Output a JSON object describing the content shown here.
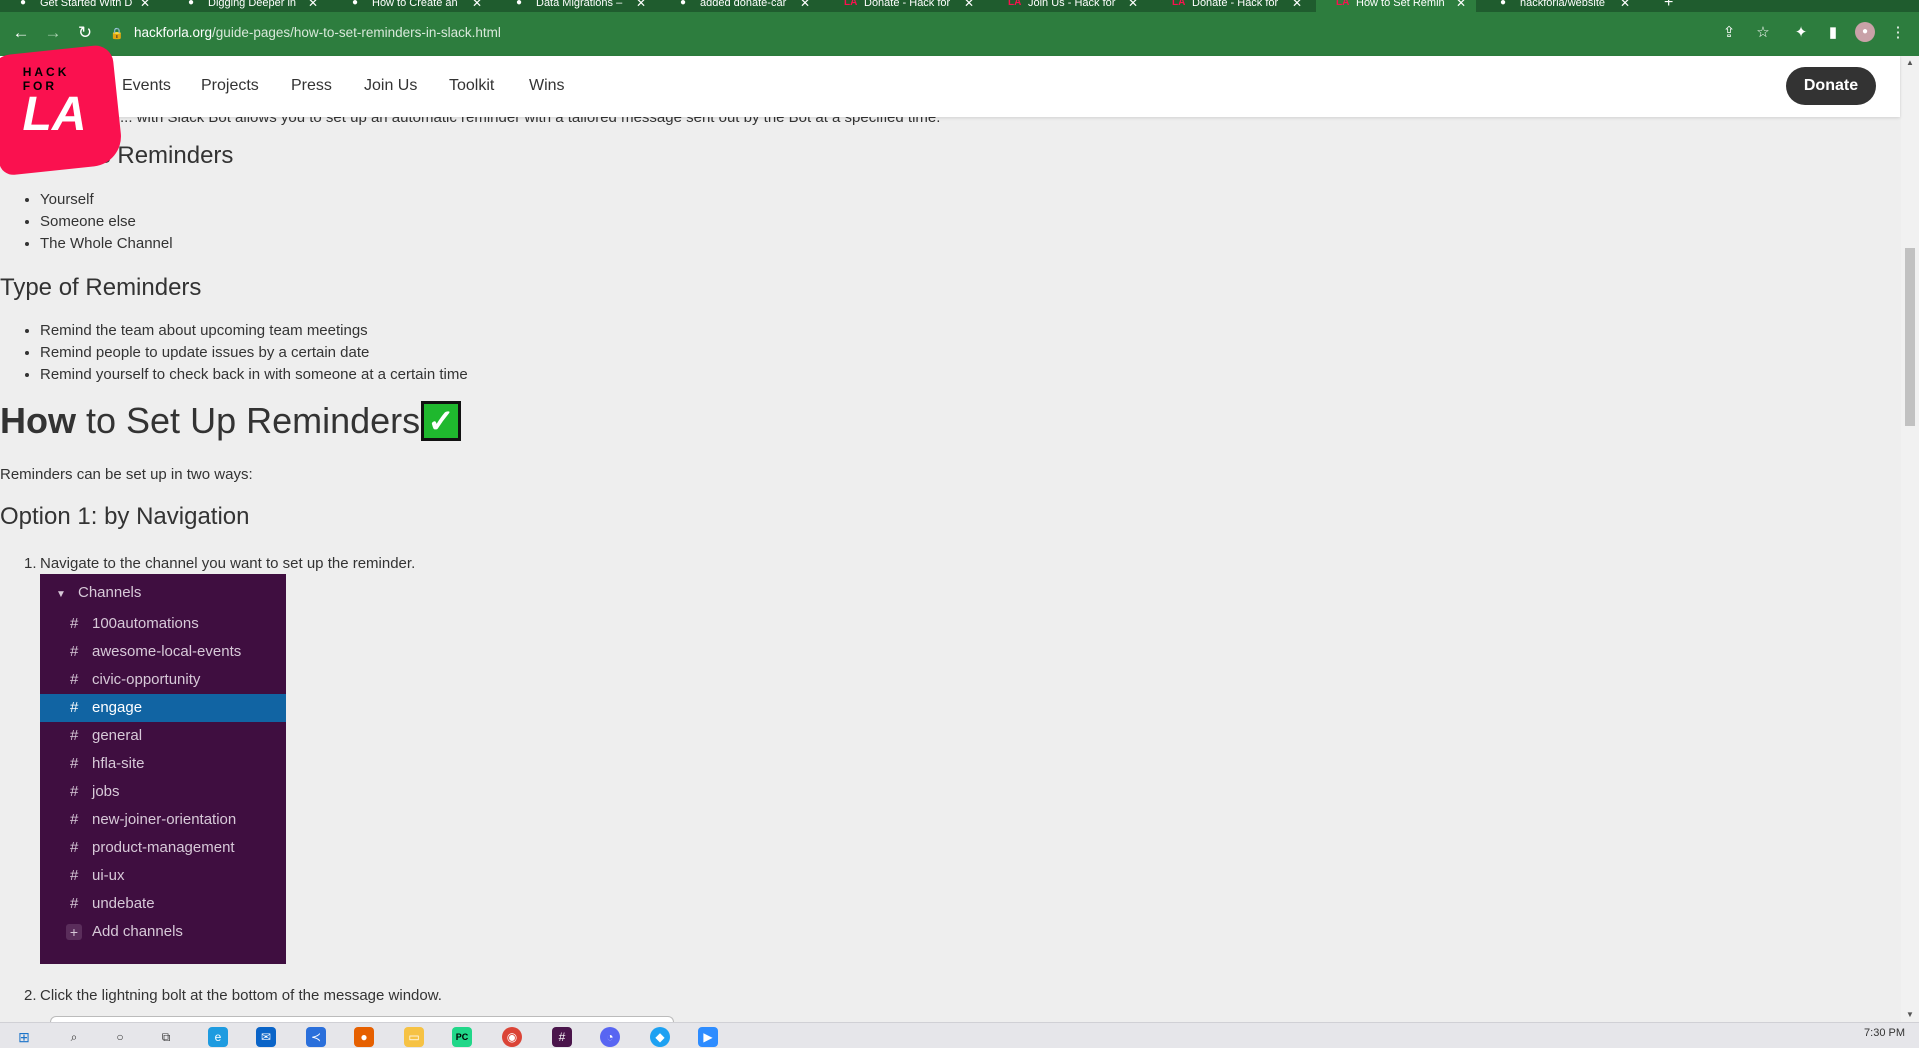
{
  "browser": {
    "tabs": [
      {
        "title": "Get Started With D",
        "icon": "github-icon"
      },
      {
        "title": "Digging Deeper in",
        "icon": "github-icon"
      },
      {
        "title": "How to Create an",
        "icon": "github-icon"
      },
      {
        "title": "Data Migrations –",
        "icon": "github-icon"
      },
      {
        "title": "added donate-car",
        "icon": "github-icon"
      },
      {
        "title": "Donate - Hack for",
        "icon": "hackforla-icon"
      },
      {
        "title": "Join Us - Hack for",
        "icon": "hackforla-icon"
      },
      {
        "title": "Donate - Hack for",
        "icon": "hackforla-icon"
      },
      {
        "title": "How to Set Remin",
        "icon": "hackforla-icon",
        "active": true
      },
      {
        "title": "hackforla/website",
        "icon": "github-icon"
      }
    ],
    "url_host": "hackforla.org",
    "url_path": "/guide-pages/how-to-set-reminders-in-slack.html"
  },
  "site": {
    "logo_small": "HACK\nFOR",
    "logo_big": "LA",
    "nav": [
      "Events",
      "Projects",
      "Press",
      "Join Us",
      "Toolkit",
      "Wins"
    ],
    "donate": "Donate"
  },
  "content": {
    "partial_line": "... with Slack Bot allows you to set up an automatic reminder with a tailored message sent out by the Bot at a specified time.",
    "who_heading": "Who Uses Reminders",
    "who_items": [
      "Yourself",
      "Someone else",
      "The Whole Channel"
    ],
    "type_heading": "Type of Reminders",
    "type_items": [
      "Remind the team about upcoming team meetings",
      "Remind people to update issues by a certain date",
      "Remind yourself to check back in with someone at a certain time"
    ],
    "how_heading_bold": "How",
    "how_heading_rest": " to Set Up Reminders",
    "how_heading_emoji": "✓",
    "intro": "Reminders can be set up in two ways:",
    "option1_heading": "Option 1: by Navigation",
    "step1": "Navigate to the channel you want to set up the reminder.",
    "step2": "Click the lightning bolt at the bottom of the message window.",
    "step1_num": "1.",
    "step2_num": "2."
  },
  "slack_panel": {
    "header": "Channels",
    "channels": [
      "100automations",
      "awesome-local-events",
      "civic-opportunity",
      "engage",
      "general",
      "hfla-site",
      "jobs",
      "new-joiner-orientation",
      "product-management",
      "ui-ux",
      "undebate"
    ],
    "selected": "engage",
    "add_label": "Add channels",
    "hash": "#"
  },
  "taskbar": {
    "clock": "7:30 PM"
  },
  "colors": {
    "chrome_green": "#2d7d3e",
    "brand_red": "#fa114f",
    "slack_purple": "#3f0e40",
    "slack_selected": "#1164a3",
    "donate_button": "#333333"
  }
}
